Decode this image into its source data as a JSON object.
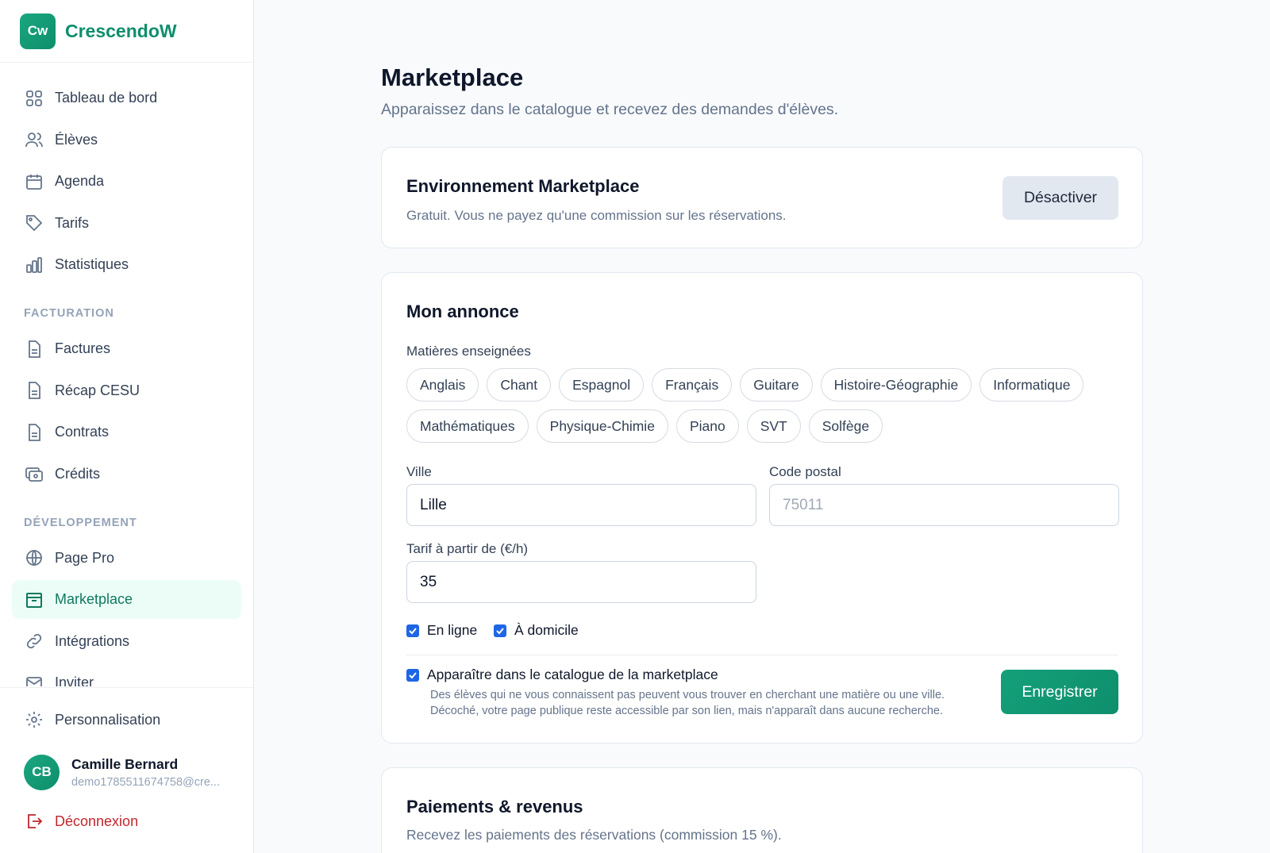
{
  "brand": {
    "logo_text": "Cw",
    "name": "CrescendoW"
  },
  "nav": {
    "items": [
      {
        "label": "Tableau de bord",
        "icon": "grid-icon"
      },
      {
        "label": "Élèves",
        "icon": "users-icon"
      },
      {
        "label": "Agenda",
        "icon": "calendar-icon"
      },
      {
        "label": "Tarifs",
        "icon": "tag-icon"
      },
      {
        "label": "Statistiques",
        "icon": "bar-chart-icon"
      }
    ],
    "section_billing": "FACTURATION",
    "billing_items": [
      {
        "label": "Factures",
        "icon": "file-icon"
      },
      {
        "label": "Récap CESU",
        "icon": "file-icon"
      },
      {
        "label": "Contrats",
        "icon": "file-icon"
      },
      {
        "label": "Crédits",
        "icon": "wallet-icon"
      }
    ],
    "section_dev": "DÉVELOPPEMENT",
    "dev_items": [
      {
        "label": "Page Pro",
        "icon": "globe-icon"
      },
      {
        "label": "Marketplace",
        "icon": "store-icon",
        "active": true
      },
      {
        "label": "Intégrations",
        "icon": "link-icon"
      },
      {
        "label": "Inviter",
        "icon": "mail-icon"
      }
    ]
  },
  "footer": {
    "settings_label": "Personnalisation",
    "user": {
      "initials": "CB",
      "name": "Camille Bernard",
      "email": "demo1785511674758@cre..."
    },
    "logout_label": "Déconnexion"
  },
  "page": {
    "title": "Marketplace",
    "subtitle": "Apparaissez dans le catalogue et recevez des demandes d'élèves."
  },
  "env_card": {
    "title": "Environnement Marketplace",
    "description": "Gratuit. Vous ne payez qu'une commission sur les réservations.",
    "button": "Désactiver"
  },
  "listing": {
    "title": "Mon annonce",
    "subjects_label": "Matières enseignées",
    "subjects": [
      "Anglais",
      "Chant",
      "Espagnol",
      "Français",
      "Guitare",
      "Histoire-Géographie",
      "Informatique",
      "Mathématiques",
      "Physique-Chimie",
      "Piano",
      "SVT",
      "Solfège"
    ],
    "city_label": "Ville",
    "city_value": "Lille",
    "postal_label": "Code postal",
    "postal_placeholder": "75011",
    "rate_label": "Tarif à partir de (€/h)",
    "rate_value": "35",
    "online_label": "En ligne",
    "online_checked": true,
    "home_label": "À domicile",
    "home_checked": true,
    "catalog_label": "Apparaître dans le catalogue de la marketplace",
    "catalog_checked": true,
    "help_line1": "Des élèves qui ne vous connaissent pas peuvent vous trouver en cherchant une matière ou une ville.",
    "help_line2": "Décoché, votre page publique reste accessible par son lien, mais n'apparaît dans aucune recherche.",
    "save_button": "Enregistrer"
  },
  "payments_card": {
    "title": "Paiements & revenus",
    "description": "Recevez les paiements des réservations (commission 15 %)."
  },
  "colors": {
    "accent": "#0e8e6c",
    "checkbox": "#1e66e5",
    "danger": "#c0262d"
  }
}
